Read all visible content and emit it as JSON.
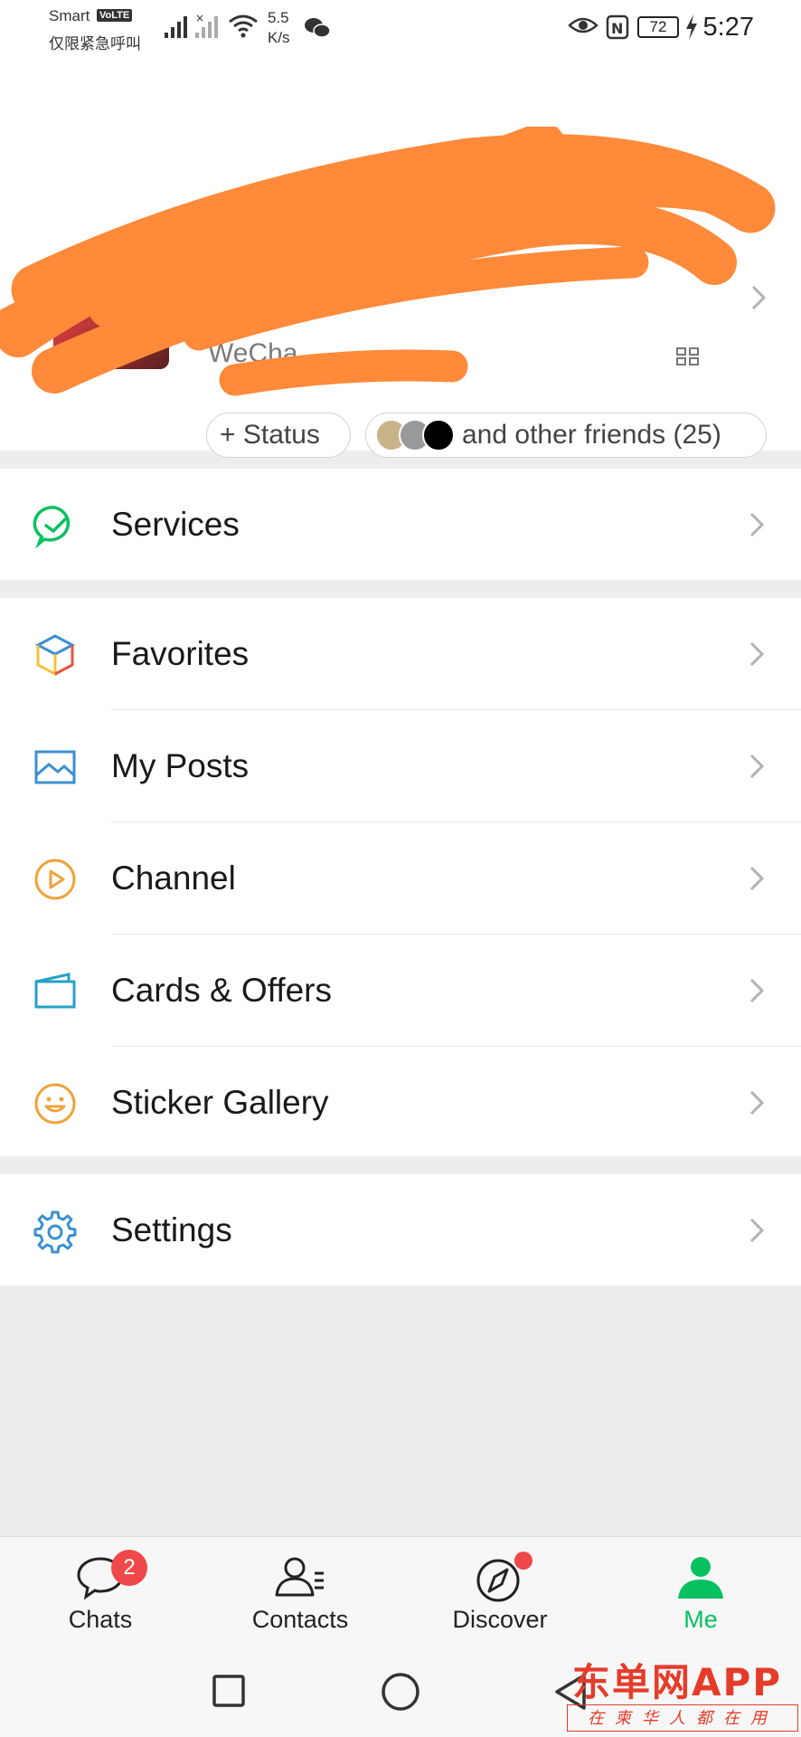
{
  "status_bar": {
    "carrier": "Smart",
    "volte": "VoLTE",
    "emergency": "仅限紧急呼叫",
    "speed_value": "5.5",
    "speed_unit": "K/s",
    "battery": "72",
    "time": "5:27"
  },
  "profile": {
    "name": "",
    "wechat_id_prefix": "WeCha",
    "status_button": "+ Status",
    "friends_text": "and other friends (25)"
  },
  "menu": {
    "services": "Services",
    "favorites": "Favorites",
    "my_posts": "My Posts",
    "channel": "Channel",
    "cards_offers": "Cards & Offers",
    "sticker_gallery": "Sticker Gallery",
    "settings": "Settings"
  },
  "tabs": {
    "chats": "Chats",
    "chats_badge": "2",
    "contacts": "Contacts",
    "discover": "Discover",
    "me": "Me"
  },
  "watermark": {
    "main": "东单网APP",
    "sub": "在柬华人都在用"
  },
  "colors": {
    "accent_green": "#07c160",
    "badge_red": "#f04848",
    "scribble_orange": "#fe8a3a"
  }
}
